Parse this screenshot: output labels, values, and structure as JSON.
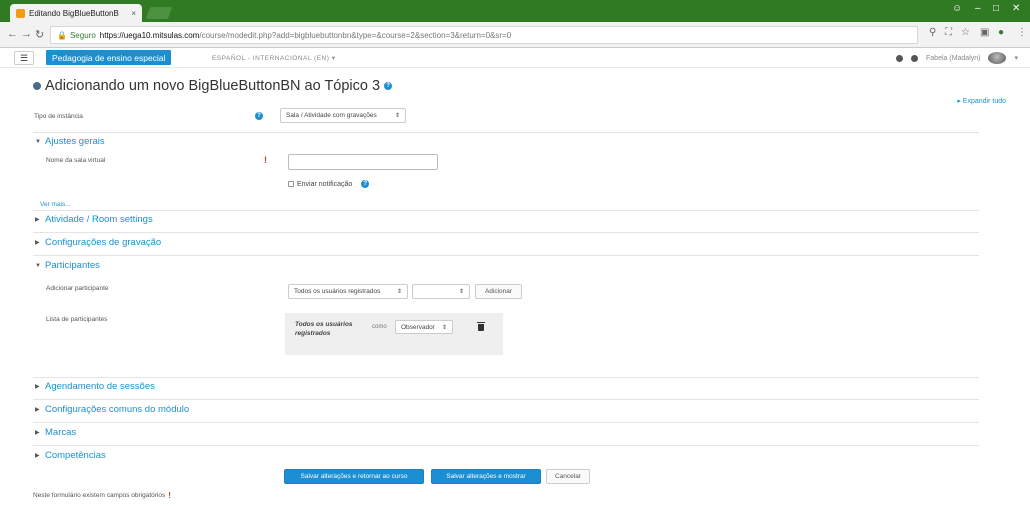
{
  "browser": {
    "tab_title": "Editando BigBlueButtonB",
    "tab_close": "×",
    "secure_label": "Seguro",
    "url_host": "https://uega10.mitsulas.com",
    "url_path": "/course/modedit.php?add=bigbluebuttonbn&type=&course=2&section=3&return=0&sr=0"
  },
  "navbar": {
    "menu_icon": "☰",
    "brand": "Pedagogia de ensino especial",
    "language": "ESPAÑOL - INTERNACIONAL (EN) ▾",
    "user_name": "Fabela (Madalyn)"
  },
  "page": {
    "title": "Adicionando um novo BigBlueButtonBN ao Tópico 3",
    "expand_all": "▸ Expandir tudo"
  },
  "form": {
    "instance_type_label": "Tipo de instância",
    "instance_type_value": "Sala / Atividade com gravações",
    "general_section": "Ajustes gerais",
    "room_name_label": "Nome da sala virtual",
    "room_name_value": "",
    "notify_label": "Enviar notificação",
    "show_more": "Ver mais...",
    "activity_section": "Atividade / Room settings",
    "recording_section": "Configurações de gravação",
    "participants_section": "Participantes",
    "add_participant_label": "Adicionar participante",
    "add_participant_select": "Todos os usuários registrados",
    "add_participant_select2": "",
    "add_button": "Adicionar",
    "participant_list_label": "Lista de participantes",
    "participant_entry": "Todos os usuários registrados",
    "participant_as": "como",
    "participant_role": "Observador",
    "schedule_section": "Agendamento de sessões",
    "common_module_section": "Configurações comuns do módulo",
    "tags_section": "Marcas",
    "competencies_section": "Competências",
    "save_return_button": "Salvar alterações e retornar ao curso",
    "save_display_button": "Salvar alterações e mostrar",
    "cancel_button": "Cancelar",
    "required_note": "Neste formulário existem campos obrigatórios"
  }
}
